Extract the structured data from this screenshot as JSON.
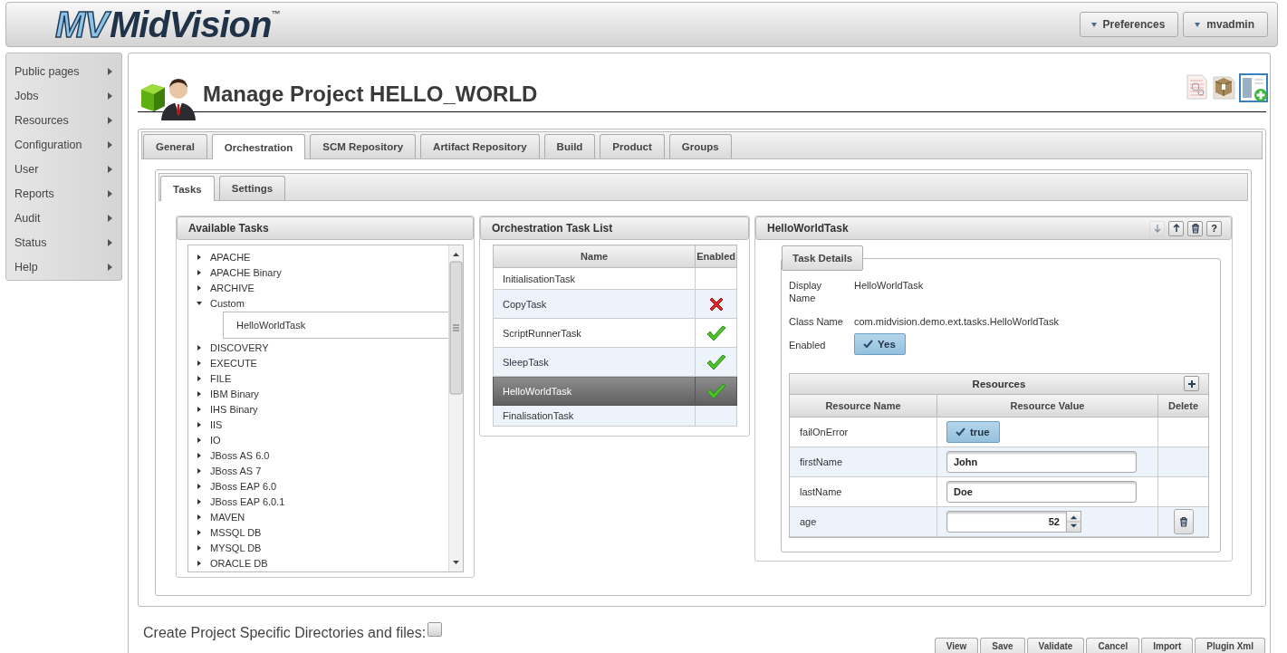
{
  "header": {
    "logo": {
      "mark": "MV",
      "name": "MidVision",
      "tm": "™"
    },
    "menus": [
      {
        "label": "Preferences"
      },
      {
        "label": "mvadmin"
      }
    ]
  },
  "sidebar": {
    "items": [
      {
        "label": "Public pages"
      },
      {
        "label": "Jobs"
      },
      {
        "label": "Resources"
      },
      {
        "label": "Configuration"
      },
      {
        "label": "User"
      },
      {
        "label": "Reports"
      },
      {
        "label": "Audit"
      },
      {
        "label": "Status"
      },
      {
        "label": "Help"
      }
    ]
  },
  "page": {
    "title": "Manage Project HELLO_WORLD",
    "tabs": [
      {
        "label": "General",
        "selected": false
      },
      {
        "label": "Orchestration",
        "selected": true
      },
      {
        "label": "SCM Repository",
        "selected": false
      },
      {
        "label": "Artifact Repository",
        "selected": false
      },
      {
        "label": "Build",
        "selected": false
      },
      {
        "label": "Product",
        "selected": false
      },
      {
        "label": "Groups",
        "selected": false
      }
    ],
    "subtabs": [
      {
        "label": "Tasks",
        "selected": true
      },
      {
        "label": "Settings",
        "selected": false
      }
    ],
    "available_tasks": {
      "title": "Available Tasks",
      "tree": [
        {
          "label": "APACHE",
          "expanded": false,
          "selected": false
        },
        {
          "label": "APACHE Binary",
          "expanded": false,
          "selected": false
        },
        {
          "label": "ARCHIVE",
          "expanded": false,
          "selected": false
        },
        {
          "label": "Custom",
          "expanded": true,
          "selected": false,
          "children": [
            {
              "label": "HelloWorldTask",
              "selected": true
            }
          ]
        },
        {
          "label": "DISCOVERY",
          "expanded": false,
          "selected": false
        },
        {
          "label": "EXECUTE",
          "expanded": false,
          "selected": false
        },
        {
          "label": "FILE",
          "expanded": false,
          "selected": false
        },
        {
          "label": "IBM Binary",
          "expanded": false,
          "selected": false
        },
        {
          "label": "IHS Binary",
          "expanded": false,
          "selected": false
        },
        {
          "label": "IIS",
          "expanded": false,
          "selected": false
        },
        {
          "label": "IO",
          "expanded": false,
          "selected": false
        },
        {
          "label": "JBoss AS 6.0",
          "expanded": false,
          "selected": false
        },
        {
          "label": "JBoss AS 7",
          "expanded": false,
          "selected": false
        },
        {
          "label": "JBoss EAP 6.0",
          "expanded": false,
          "selected": false
        },
        {
          "label": "JBoss EAP 6.0.1",
          "expanded": false,
          "selected": false
        },
        {
          "label": "MAVEN",
          "expanded": false,
          "selected": false
        },
        {
          "label": "MSSQL DB",
          "expanded": false,
          "selected": false
        },
        {
          "label": "MYSQL DB",
          "expanded": false,
          "selected": false
        },
        {
          "label": "ORACLE DB",
          "expanded": false,
          "selected": false
        }
      ]
    },
    "task_list": {
      "title": "Orchestration Task List",
      "columns": [
        "Name",
        "Enabled"
      ],
      "rows": [
        {
          "name": "InitialisationTask",
          "kind": "blank",
          "selected": false
        },
        {
          "name": "CopyTask",
          "kind": "cross",
          "selected": false
        },
        {
          "name": "ScriptRunnerTask",
          "kind": "tick",
          "selected": false
        },
        {
          "name": "SleepTask",
          "kind": "tick",
          "selected": false
        },
        {
          "name": "HelloWorldTask",
          "kind": "tick",
          "selected": true
        },
        {
          "name": "FinalisationTask",
          "kind": "blank",
          "selected": false
        }
      ]
    },
    "task": {
      "title": "HelloWorldTask",
      "tools": [
        {
          "kind": "down",
          "disabled": true
        },
        {
          "kind": "up",
          "disabled": false
        },
        {
          "kind": "delete",
          "disabled": false
        },
        {
          "kind": "help",
          "label": "?",
          "disabled": false
        }
      ],
      "section": "Task Details",
      "fields": [
        {
          "label": "Display Name",
          "value": "HelloWorldTask"
        },
        {
          "label": "Class Name",
          "value": "com.midvision.demo.ext.tasks.HelloWorldTask"
        }
      ],
      "enabled": {
        "label": "Enabled",
        "value": "Yes",
        "checked": true
      },
      "resources": {
        "title": "Resources",
        "columns": [
          "Resource Name",
          "Resource Value",
          "Delete"
        ],
        "rows": [
          {
            "name": "failOnError",
            "kind": "toggle",
            "value": "true",
            "checked": true,
            "deletable": false
          },
          {
            "name": "firstName",
            "kind": "text",
            "value": "John",
            "deletable": false
          },
          {
            "name": "lastName",
            "kind": "text",
            "value": "Doe",
            "deletable": false
          },
          {
            "name": "age",
            "kind": "number",
            "value": "52",
            "deletable": true
          }
        ]
      }
    },
    "create_dirs": {
      "label": "Create Project Specific Directories and files:",
      "checked": false
    },
    "actions": [
      {
        "label": "View"
      },
      {
        "label": "Save"
      },
      {
        "label": "Validate"
      },
      {
        "label": "Cancel"
      },
      {
        "label": "Import"
      },
      {
        "label": "Plugin Xml"
      }
    ]
  }
}
